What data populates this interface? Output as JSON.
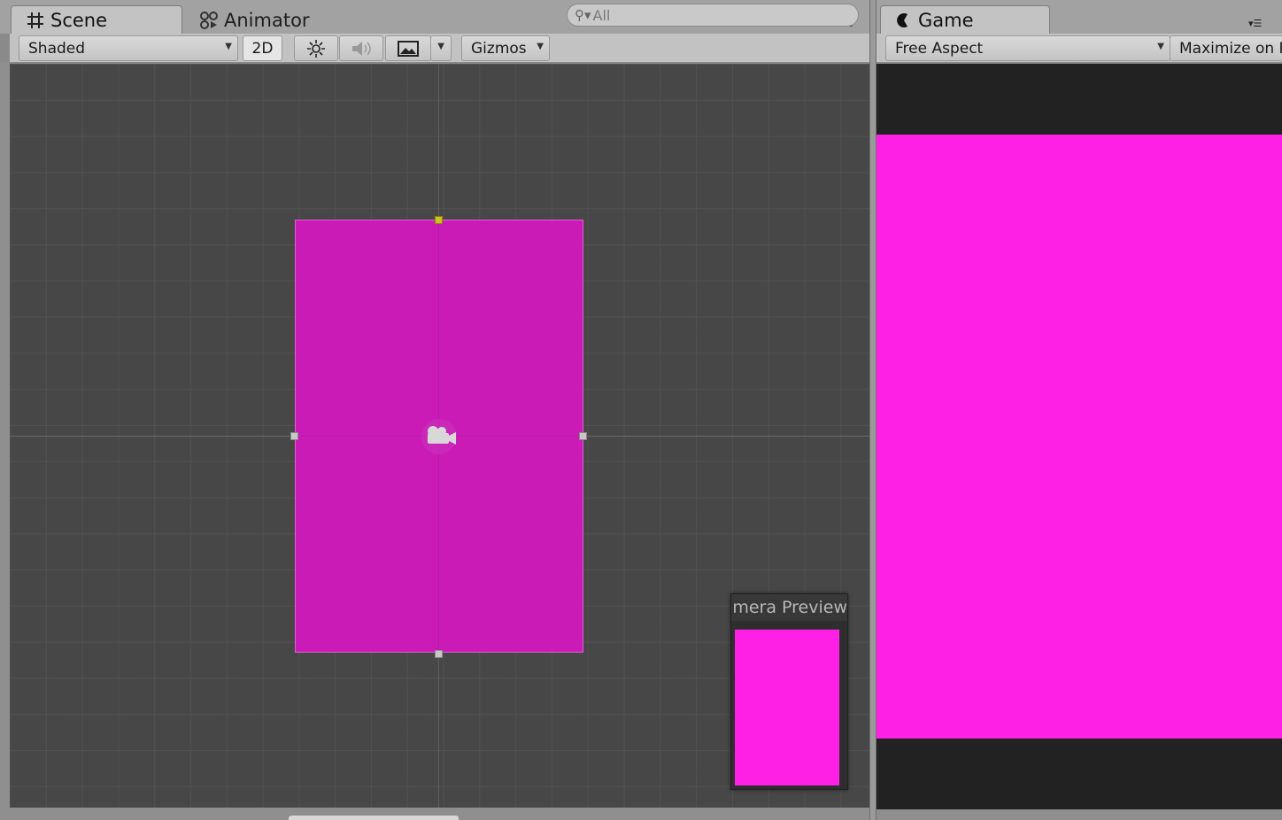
{
  "scene": {
    "tabs": [
      {
        "label": "Scene",
        "icon": "grid-icon"
      },
      {
        "label": "Animator",
        "icon": "animator-icon"
      }
    ],
    "toolbar": {
      "shading_mode": "Shaded",
      "mode_2d_label": "2D",
      "lighting_icon": "sun-icon",
      "audio_icon": "speaker-icon",
      "effects_icon": "image-icon",
      "gizmos_label": "Gizmos",
      "search_placeholder": "All"
    },
    "camera_preview": {
      "title": "Camera Preview"
    },
    "colors": {
      "camera_rect": "#cb1bb6",
      "preview_fill": "#ff20e6"
    }
  },
  "game": {
    "tab": {
      "label": "Game",
      "icon": "game-icon"
    },
    "toolbar": {
      "aspect_label": "Free Aspect",
      "maximize_label": "Maximize on Play"
    },
    "colors": {
      "canvas": "#ff20e6"
    }
  }
}
